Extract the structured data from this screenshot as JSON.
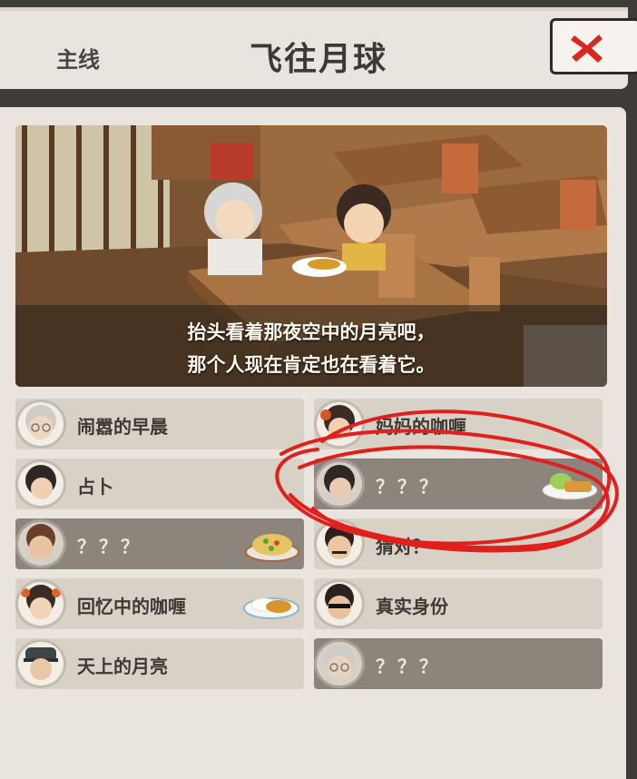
{
  "header": {
    "chapter": "主线",
    "title": "飞往月球",
    "close_icon": "close-x-icon"
  },
  "scene": {
    "caption_line1": "抬头看着那夜空中的月亮吧，",
    "caption_line2": "那个人现在肯定也在看着它。"
  },
  "stories": [
    {
      "label": "闹嚣的早晨",
      "locked": false,
      "avatar": "grandma-avatar"
    },
    {
      "label": "妈妈的咖喱",
      "locked": false,
      "avatar": "mother-avatar"
    },
    {
      "label": "占卜",
      "locked": false,
      "avatar": "woman-avatar"
    },
    {
      "label": "？？？",
      "locked": true,
      "avatar": "woman-avatar",
      "dish": "tonkatsu-dish-icon"
    },
    {
      "label": "？？？",
      "locked": true,
      "avatar": "man-avatar",
      "dish": "fried-rice-dish-icon"
    },
    {
      "label": "猜对？",
      "locked": false,
      "avatar": "mustache-man-avatar"
    },
    {
      "label": "回忆中的咖喱",
      "locked": false,
      "avatar": "girl-avatar",
      "dish": "curry-rice-dish-icon"
    },
    {
      "label": "真实身份",
      "locked": false,
      "avatar": "sunglasses-man-avatar"
    },
    {
      "label": "天上的月亮",
      "locked": false,
      "avatar": "capped-man-avatar"
    },
    {
      "label": "？？？",
      "locked": true,
      "avatar": "grandma-avatar"
    }
  ],
  "colors": {
    "card_unlocked": "#d8d1c6",
    "card_locked": "#8d857c",
    "annotation_red": "#e0201c",
    "close_red": "#d9281e"
  }
}
